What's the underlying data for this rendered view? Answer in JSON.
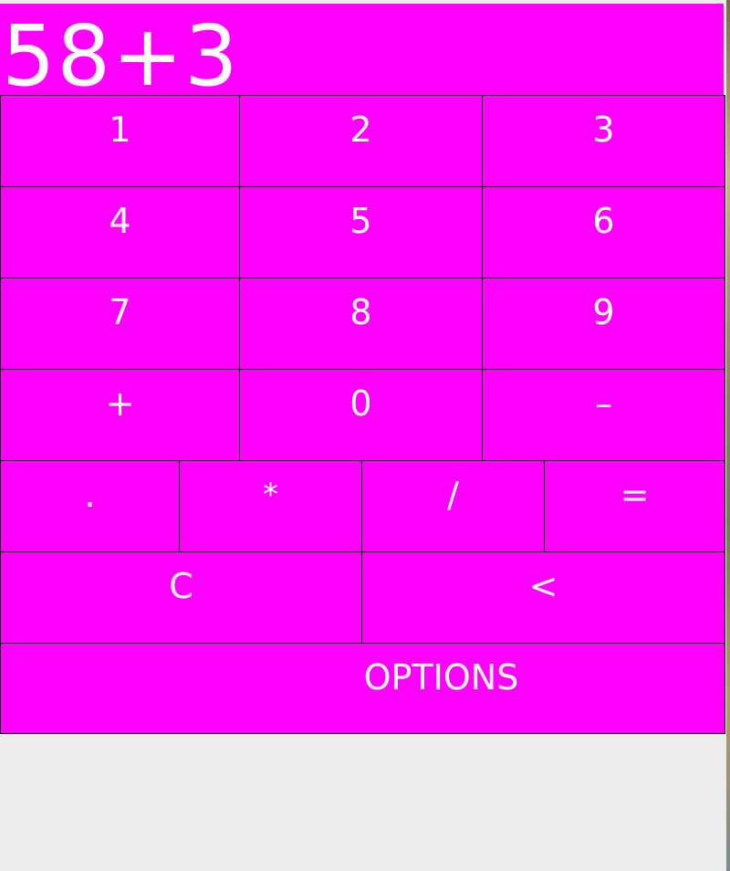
{
  "display": {
    "expression": "58+3"
  },
  "keypad": {
    "row1": [
      "1",
      "2",
      "3"
    ],
    "row2": [
      "4",
      "5",
      "6"
    ],
    "row3": [
      "7",
      "8",
      "9"
    ],
    "row4": [
      "+",
      "0",
      "–"
    ],
    "row5": [
      ".",
      "*",
      "/",
      "="
    ],
    "row6": [
      "C",
      "<"
    ],
    "options_label": "OPTIONS"
  },
  "colors": {
    "button_background": "#ff00ff",
    "button_text": "#ffffff",
    "border": "#000000",
    "window_background": "#ececec"
  }
}
